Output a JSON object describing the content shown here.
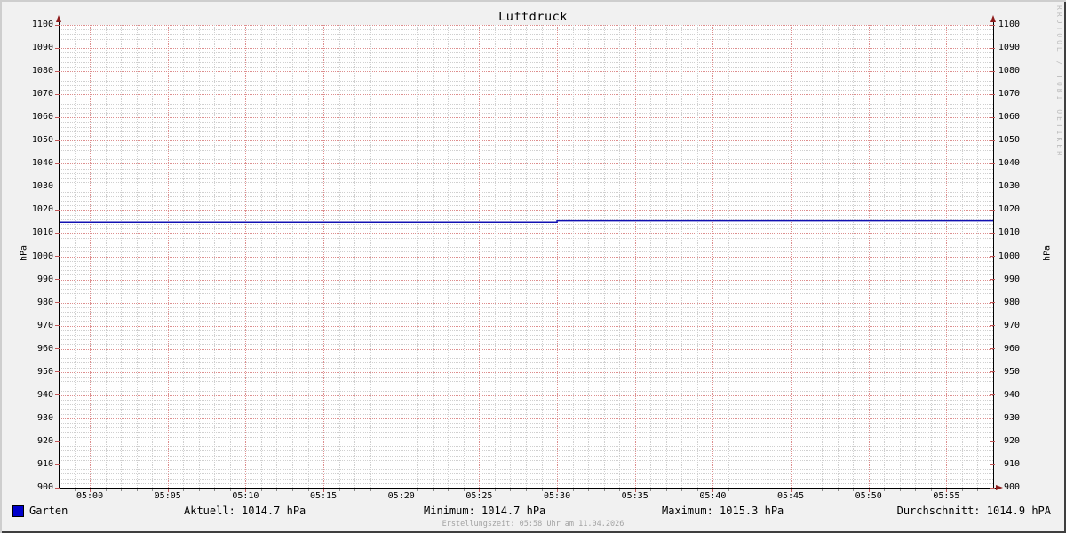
{
  "title": "Luftdruck",
  "watermark": "RRDTOOL / TOBI OETIKER",
  "footer": "Erstellungszeit: 05:58 Uhr am 11.04.2026",
  "y_axis": {
    "unit_left": "hPa",
    "unit_right": "hPa"
  },
  "legend": {
    "series_name": "Garten",
    "series_color": "#0000cc",
    "aktuell": "Aktuell: 1014.7 hPa",
    "minimum": "Minimum: 1014.7 hPa",
    "maximum": "Maximum: 1015.3 hPa",
    "durchschnitt": "Durchschnitt: 1014.9 hPA"
  },
  "chart_data": {
    "type": "line",
    "title": "Luftdruck",
    "ylabel": "hPa",
    "ylim": [
      900,
      1100
    ],
    "y_major_step": 10,
    "y_minor_step": 2,
    "y_tick_labels": [
      1100,
      1090,
      1080,
      1070,
      1060,
      1050,
      1040,
      1030,
      1020,
      1010,
      1000,
      990,
      980,
      970,
      960,
      950,
      940,
      930,
      920,
      910,
      900
    ],
    "x_window": {
      "start": "04:58",
      "end": "05:58"
    },
    "x_major_step_min": 5,
    "x_minor_step_min": 1,
    "x_tick_labels": [
      "05:00",
      "05:05",
      "05:10",
      "05:15",
      "05:20",
      "05:25",
      "05:30",
      "05:35",
      "05:40",
      "05:45",
      "05:50",
      "05:55"
    ],
    "grid": {
      "major_color": "#dd8f8f",
      "minor_color": "#d0d0d0",
      "grid_on": true
    },
    "legend_position": "bottom",
    "series": [
      {
        "name": "Garten",
        "color": "#1111b2",
        "points": [
          {
            "time": "04:58",
            "value": 1014.7
          },
          {
            "time": "05:30",
            "value": 1014.7
          },
          {
            "time": "05:30",
            "value": 1015.3
          },
          {
            "time": "05:58",
            "value": 1015.3
          }
        ]
      }
    ],
    "stats": {
      "aktuell": 1014.7,
      "minimum": 1014.7,
      "maximum": 1015.3,
      "durchschnitt": 1014.9,
      "unit": "hPa"
    }
  },
  "colors": {
    "background": "#f1f1f1",
    "canvas": "#ffffff",
    "axis": "#000000",
    "arrow": "#8d1c1c",
    "border_light": "#cecece",
    "border_dark": "#3f3f3f"
  }
}
